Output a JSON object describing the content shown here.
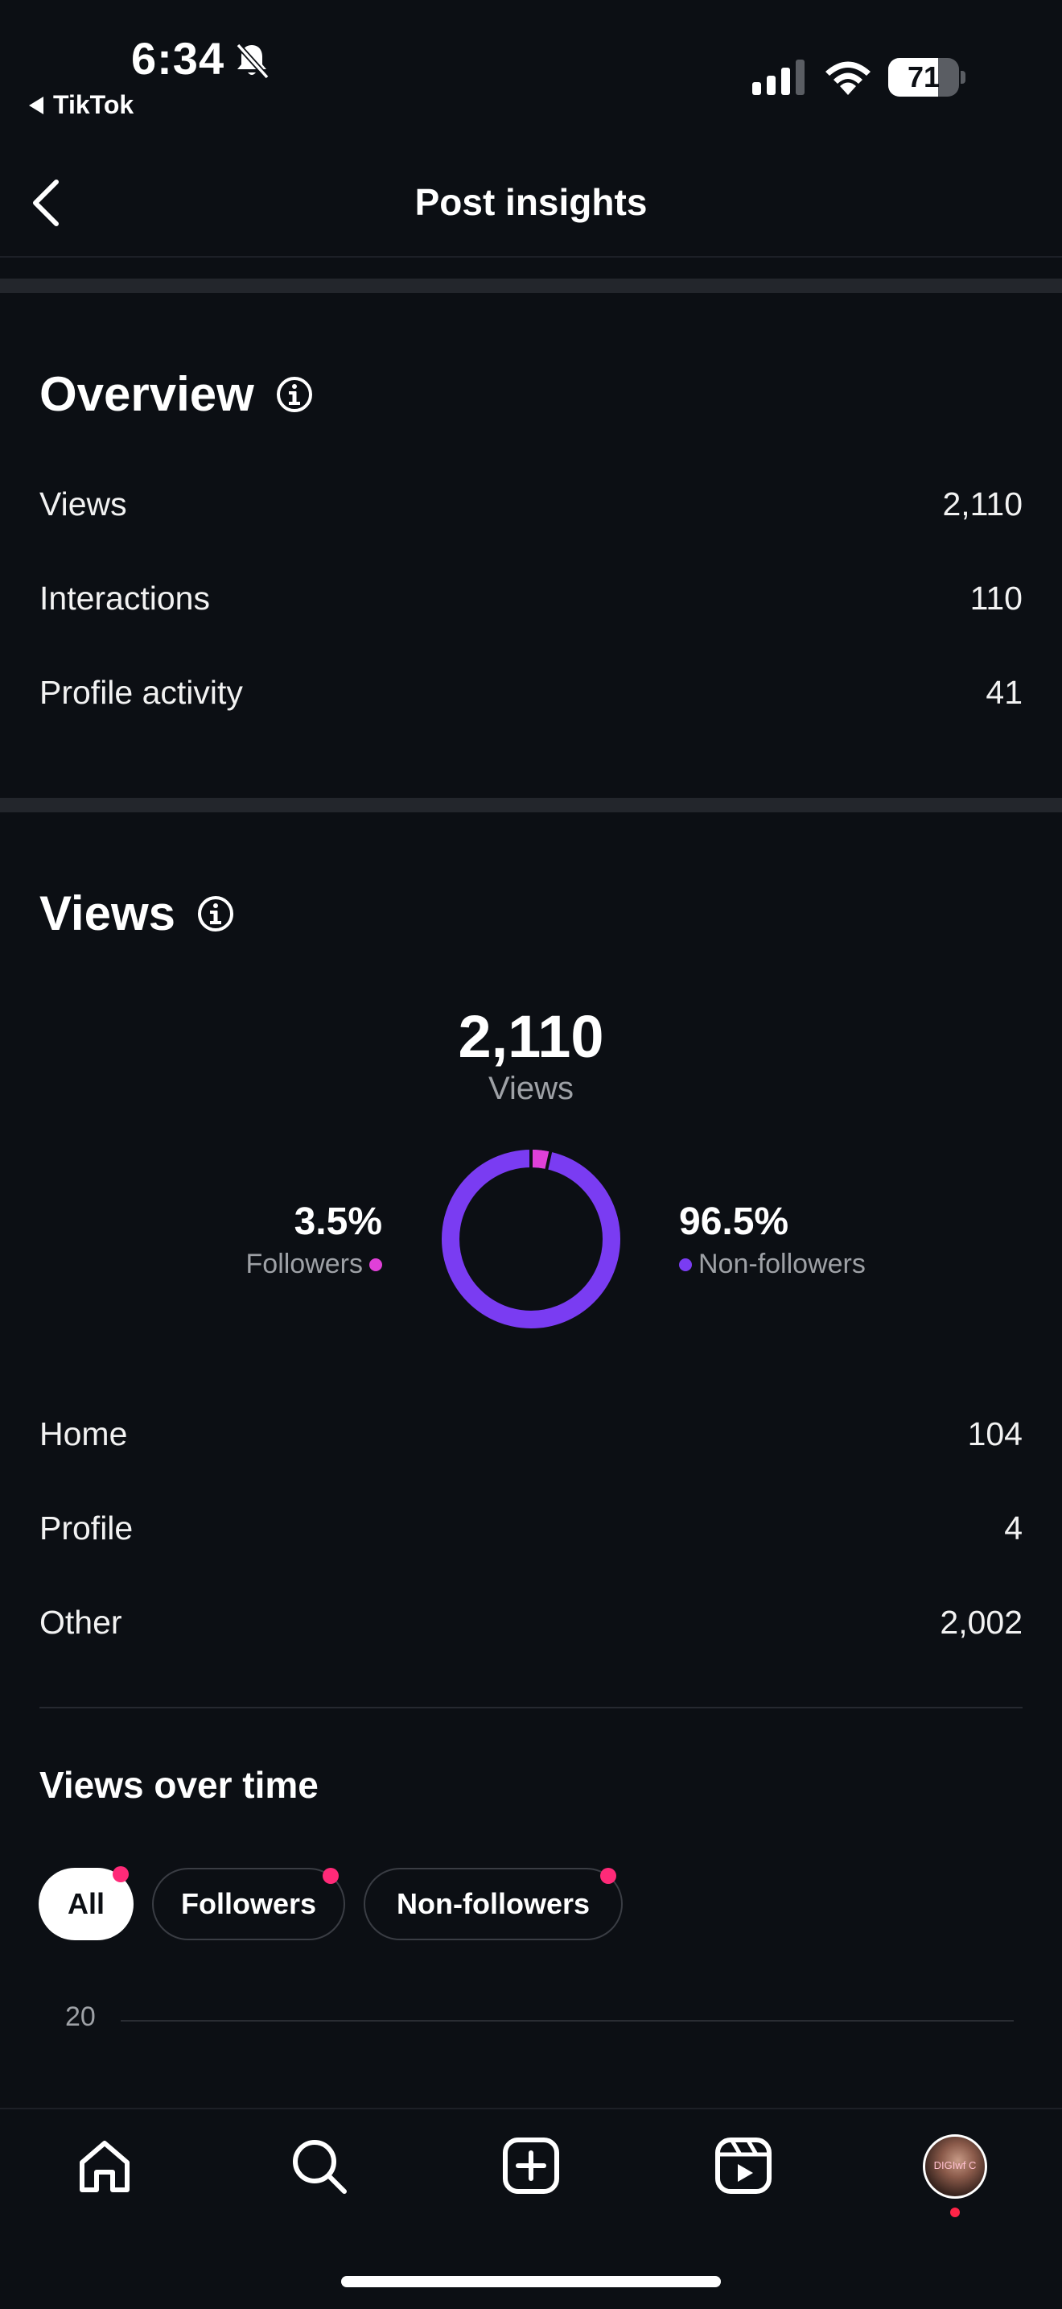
{
  "status_bar": {
    "time": "6:34",
    "back_app": "TikTok",
    "battery_percent": "71",
    "battery_level": 0.71
  },
  "header": {
    "title": "Post insights"
  },
  "overview": {
    "title": "Overview",
    "rows": [
      {
        "label": "Views",
        "value": "2,110"
      },
      {
        "label": "Interactions",
        "value": "110"
      },
      {
        "label": "Profile activity",
        "value": "41"
      }
    ]
  },
  "views": {
    "title": "Views",
    "total": "2,110",
    "total_label": "Views",
    "followers_pct": "3.5%",
    "followers_label": "Followers",
    "non_followers_pct": "96.5%",
    "non_followers_label": "Non-followers",
    "followers_share": 0.035,
    "non_followers_share": 0.965,
    "colors": {
      "followers": "#e040d8",
      "non_followers": "#7a3cf2"
    },
    "sources": [
      {
        "label": "Home",
        "value": "104"
      },
      {
        "label": "Profile",
        "value": "4"
      },
      {
        "label": "Other",
        "value": "2,002"
      }
    ]
  },
  "views_over_time": {
    "title": "Views over time",
    "filters": [
      "All",
      "Followers",
      "Non-followers"
    ],
    "selected_filter": "All",
    "y_tick": "20"
  },
  "tabbar": {
    "icons": [
      "home-icon",
      "search-icon",
      "create-icon",
      "reels-icon",
      "profile-avatar"
    ],
    "avatar_text": "DIGIwf C"
  },
  "colors": {
    "background": "#0c0f14",
    "accent_dot": "#ff2a78"
  }
}
